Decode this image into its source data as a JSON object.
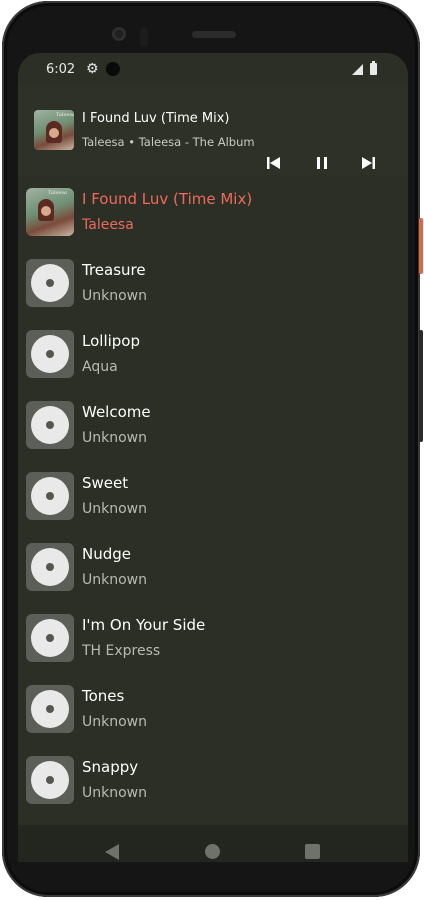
{
  "status_bar": {
    "time": "6:02",
    "icons": [
      "gear-icon",
      "signal-icon",
      "battery-icon"
    ]
  },
  "mini_player": {
    "title": "I Found Luv (Time Mix)",
    "subtitle": "Taleesa • Taleesa - The Album",
    "album_art_text": "Taleesa",
    "controls": [
      "skip-previous-icon",
      "pause-icon",
      "skip-next-icon"
    ]
  },
  "songs": [
    {
      "title": "I Found Luv (Time Mix)",
      "artist": "Taleesa",
      "active": true
    },
    {
      "title": "Treasure",
      "artist": "Unknown"
    },
    {
      "title": "Lollipop",
      "artist": "Aqua"
    },
    {
      "title": "Welcome",
      "artist": "Unknown"
    },
    {
      "title": "Sweet",
      "artist": "Unknown"
    },
    {
      "title": "Nudge",
      "artist": "Unknown"
    },
    {
      "title": "I'm On Your Side",
      "artist": "TH Express"
    },
    {
      "title": "Tones",
      "artist": "Unknown"
    },
    {
      "title": "Snappy",
      "artist": "Unknown"
    }
  ],
  "colors": {
    "background": "#2c2f26",
    "accent": "#ec6b5b",
    "primary_text": "#ffffff",
    "secondary_text": "#b9bbb3"
  },
  "nav_bar": {
    "icons": [
      "back-icon",
      "home-icon",
      "recents-icon"
    ]
  }
}
